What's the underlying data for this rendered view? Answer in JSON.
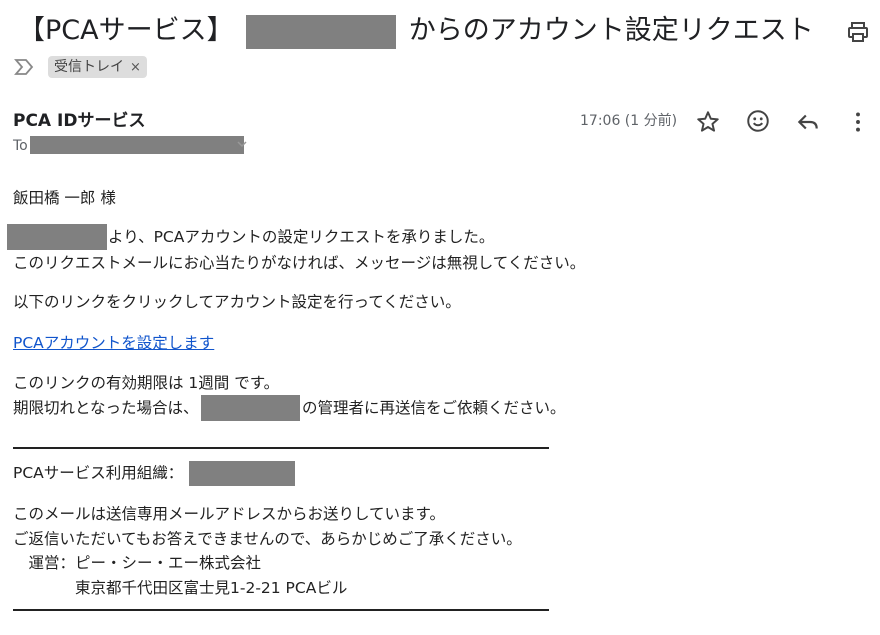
{
  "subject": {
    "prefix": "【PCAサービス】",
    "suffix": "からのアカウント設定リクエスト"
  },
  "toolbar": {
    "print_icon": "printer-icon"
  },
  "labels": [
    {
      "name": "受信トレイ",
      "remove": "×"
    }
  ],
  "header": {
    "sender": "PCA IDサービス",
    "to_label": "To",
    "time": "17:06 (1 分前)",
    "icons": [
      "star-icon",
      "emoji-icon",
      "reply-icon",
      "more-vert-icon"
    ]
  },
  "body": {
    "greeting": "飯田橋 一郎 様",
    "line1_suffix": "より、PCAアカウントの設定リクエストを承りました。",
    "line2": "このリクエストメールにお心当たりがなければ、メッセージは無視してください。",
    "line3": "以下のリンクをクリックしてアカウント設定を行ってください。",
    "link": "PCAアカウントを設定します",
    "expiry": "このリンクの有効期限は 1週間 です。",
    "expired_prefix": "期限切れとなった場合は、",
    "expired_suffix": "の管理者に再送信をご依頼ください。",
    "org_label": "PCAサービス利用組織：",
    "notice1": "このメールは送信専用メールアドレスからお送りしています。",
    "notice2": "ご返信いただいてもお答えできませんので、あらかじめご了承ください。",
    "operator": "　運営：ピー・シー・エー株式会社",
    "address": "　　　　東京都千代田区富士見1-2-21 PCAビル"
  }
}
